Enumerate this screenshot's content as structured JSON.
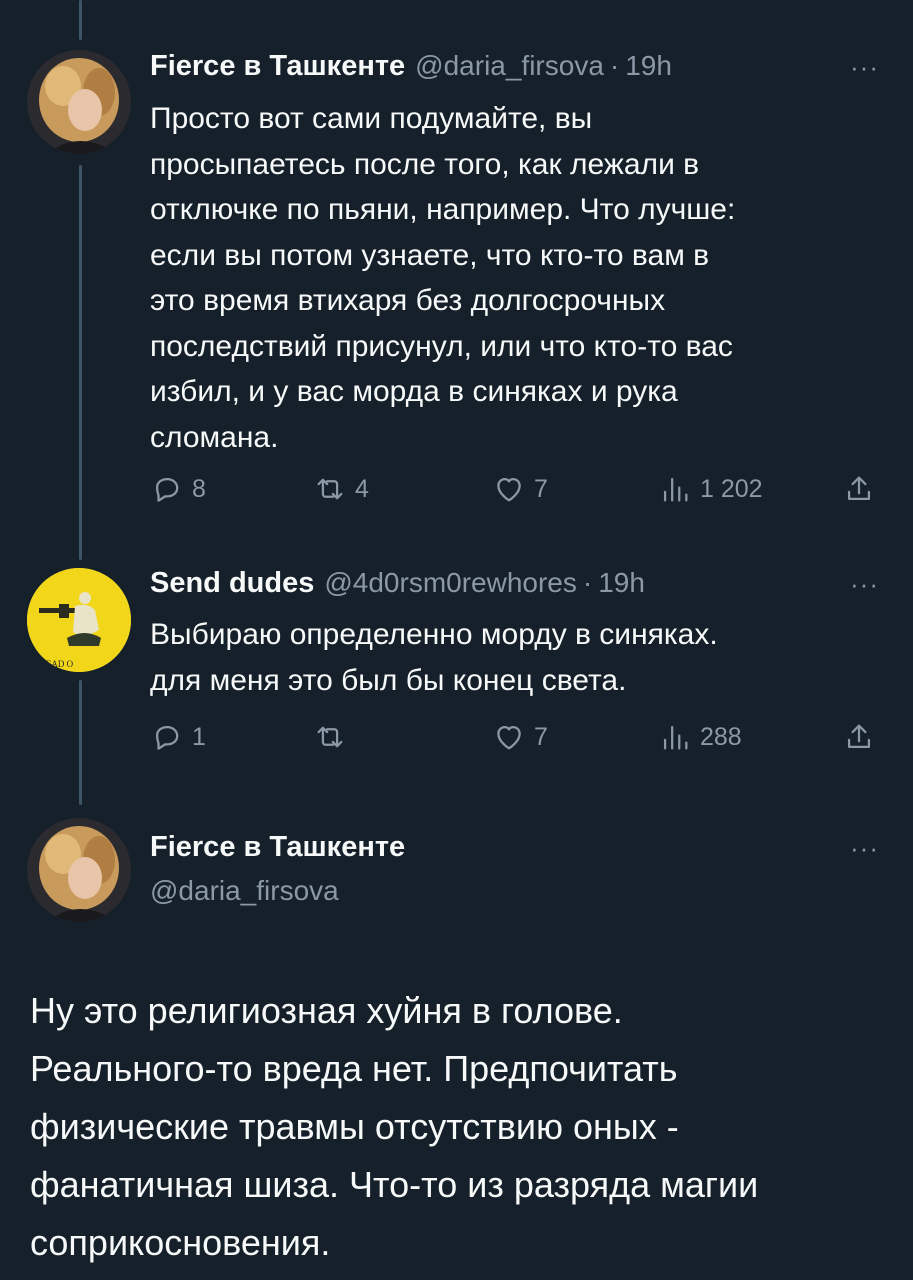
{
  "tweets": [
    {
      "name": "Fierce в Ташкенте",
      "handle": "@daria_firsova",
      "time": "19h",
      "text": "Просто вот сами подумайте, вы просыпаетесь после того, как лежали в отключке по пьяни, например. Что лучше: если вы потом узнаете, что кто-то вам в это время втихаря без долгосрочных последствий присунул, или что кто-то вас избил, и у вас морда в синяках и рука сломана.",
      "lines": [
        "Просто вот сами подумайте, вы",
        "просыпаетесь после того, как лежали в",
        "отключке по пьяни, например. Что лучше:",
        "если вы потом узнаете, что кто-то вам в",
        "это время втихаря без долгосрочных",
        "последствий присунул, или что кто-то вас",
        "избил, и у вас морда в синяках и рука",
        "сломана."
      ],
      "replies": "8",
      "retweets": "4",
      "likes": "7",
      "views": "1 202"
    },
    {
      "name": "Send dudes",
      "handle": "@4d0rsm0rewhores",
      "time": "19h",
      "avatar_text": "T TREAD O",
      "lines": [
        "Выбираю определенно морду в синяках.",
        "для меня это был бы конец света."
      ],
      "replies": "1",
      "retweets": "",
      "likes": "7",
      "views": "288"
    }
  ],
  "main_tweet": {
    "name": "Fierce в Ташкенте",
    "handle": "@daria_firsova",
    "lines": [
      "Ну это религиозная хуйня в голове.",
      "Реального-то вреда нет. Предпочитать",
      "физические травмы отсутствию оных -",
      "фанатичная шиза. Что-то из разряда магии",
      "соприкосновения."
    ]
  },
  "more_label": "···",
  "separator": "·",
  "icons": {
    "reply": "reply-icon",
    "retweet": "retweet-icon",
    "like": "heart-icon",
    "views": "views-icon",
    "share": "share-icon",
    "more": "more-icon"
  },
  "colors": {
    "background": "#15202b",
    "text": "#f7f9f9",
    "muted": "#8b98a5",
    "thread_line": "#3d5466",
    "avatar_yellow": "#f1d61a"
  }
}
